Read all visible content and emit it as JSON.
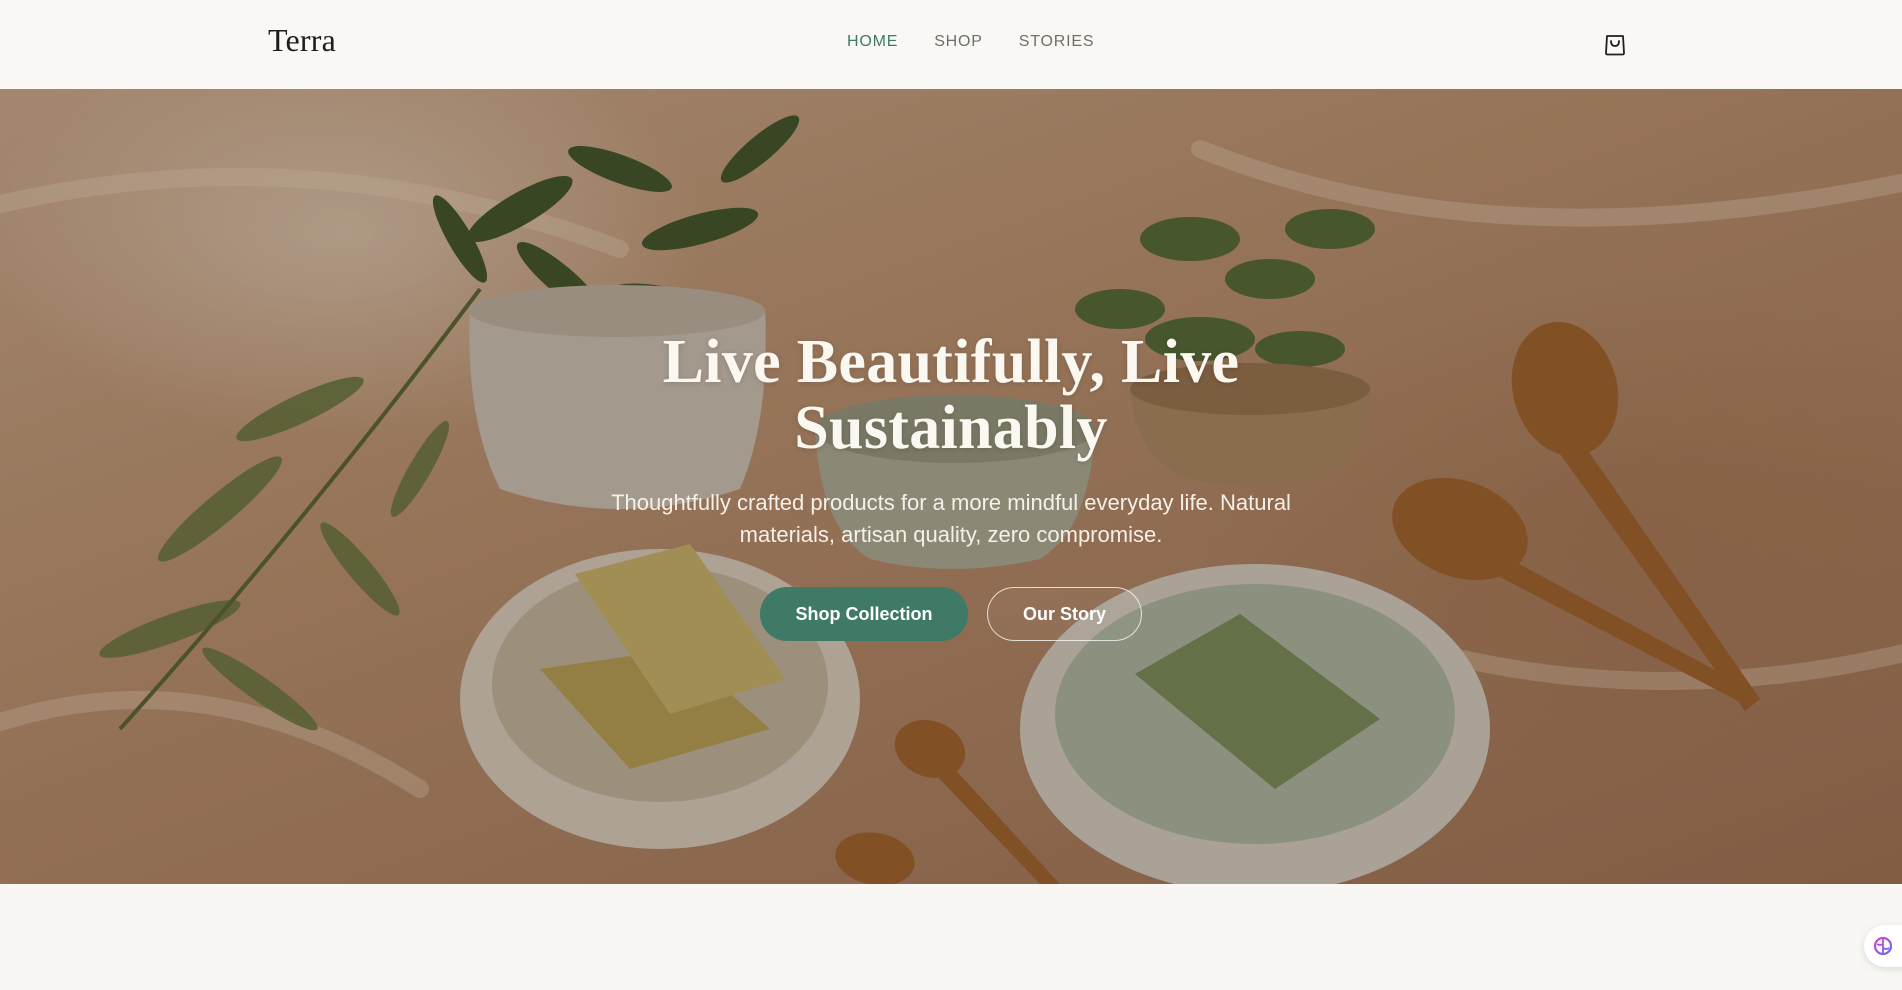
{
  "header": {
    "logo": "Terra",
    "nav": [
      {
        "label": "HOME",
        "active": true
      },
      {
        "label": "SHOP",
        "active": false
      },
      {
        "label": "STORIES",
        "active": false
      }
    ],
    "cart_icon": "shopping-bag-icon"
  },
  "hero": {
    "title_line1": "Live Beautifully, Live",
    "title_line2": "Sustainably",
    "subtitle": "Thoughtfully crafted products for a more mindful everyday life. Natural materials, artisan quality, zero compromise.",
    "primary_button": "Shop Collection",
    "secondary_button": "Our Story"
  },
  "floating_widget": {
    "icon": "brain-icon"
  },
  "colors": {
    "accent": "#3f7a66",
    "nav_active": "#3f7a65",
    "page_background": "#f9f7f3"
  }
}
